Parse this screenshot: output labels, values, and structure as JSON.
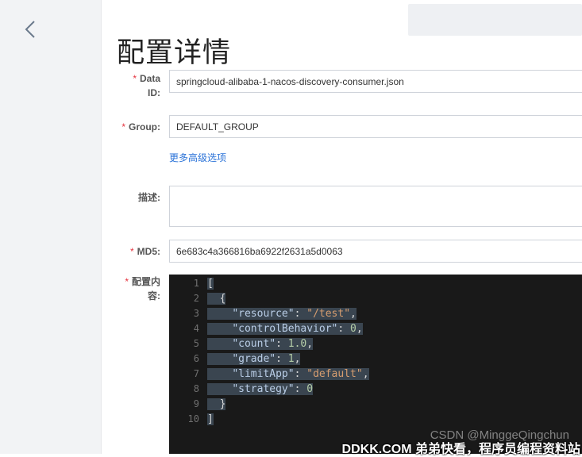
{
  "header": {
    "title": "配置详情"
  },
  "form": {
    "data_id": {
      "label_line1": "Data",
      "label_line2": "ID:",
      "value": "springcloud-alibaba-1-nacos-discovery-consumer.json"
    },
    "group": {
      "label": "Group:",
      "value": "DEFAULT_GROUP"
    },
    "advanced_link": "更多高级选项",
    "description": {
      "label": "描述:",
      "value": ""
    },
    "md5": {
      "label": "MD5:",
      "value": "6e683c4a366816ba6922f2631a5d0063"
    },
    "content": {
      "label_line1": "配置内",
      "label_line2": "容:"
    },
    "required_mark": "*"
  },
  "editor": {
    "line_numbers": [
      "1",
      "2",
      "3",
      "4",
      "5",
      "6",
      "7",
      "8",
      "9",
      "10"
    ],
    "lines": [
      [
        {
          "t": "[",
          "c": "p"
        }
      ],
      [
        {
          "t": "  {",
          "c": "p"
        }
      ],
      [
        {
          "t": "    ",
          "c": "p"
        },
        {
          "t": "\"resource\"",
          "c": "key"
        },
        {
          "t": ": ",
          "c": "p"
        },
        {
          "t": "\"/test\"",
          "c": "str"
        },
        {
          "t": ",",
          "c": "p"
        }
      ],
      [
        {
          "t": "    ",
          "c": "p"
        },
        {
          "t": "\"controlBehavior\"",
          "c": "key"
        },
        {
          "t": ": ",
          "c": "p"
        },
        {
          "t": "0",
          "c": "num"
        },
        {
          "t": ",",
          "c": "p"
        }
      ],
      [
        {
          "t": "    ",
          "c": "p"
        },
        {
          "t": "\"count\"",
          "c": "key"
        },
        {
          "t": ": ",
          "c": "p"
        },
        {
          "t": "1.0",
          "c": "num"
        },
        {
          "t": ",",
          "c": "p"
        }
      ],
      [
        {
          "t": "    ",
          "c": "p"
        },
        {
          "t": "\"grade\"",
          "c": "key"
        },
        {
          "t": ": ",
          "c": "p"
        },
        {
          "t": "1",
          "c": "num"
        },
        {
          "t": ",",
          "c": "p"
        }
      ],
      [
        {
          "t": "    ",
          "c": "p"
        },
        {
          "t": "\"limitApp\"",
          "c": "key"
        },
        {
          "t": ": ",
          "c": "p"
        },
        {
          "t": "\"default\"",
          "c": "str"
        },
        {
          "t": ",",
          "c": "p"
        }
      ],
      [
        {
          "t": "    ",
          "c": "p"
        },
        {
          "t": "\"strategy\"",
          "c": "key"
        },
        {
          "t": ": ",
          "c": "p"
        },
        {
          "t": "0",
          "c": "num"
        }
      ],
      [
        {
          "t": "  }",
          "c": "p"
        }
      ],
      [
        {
          "t": "]",
          "c": "p"
        }
      ]
    ]
  },
  "watermarks": {
    "csdn": "CSDN @MinggeQingchun",
    "site": "DDKK.COM 弟弟快看，程序员编程资料站"
  },
  "icons": {
    "back": "chevron-left-icon"
  }
}
